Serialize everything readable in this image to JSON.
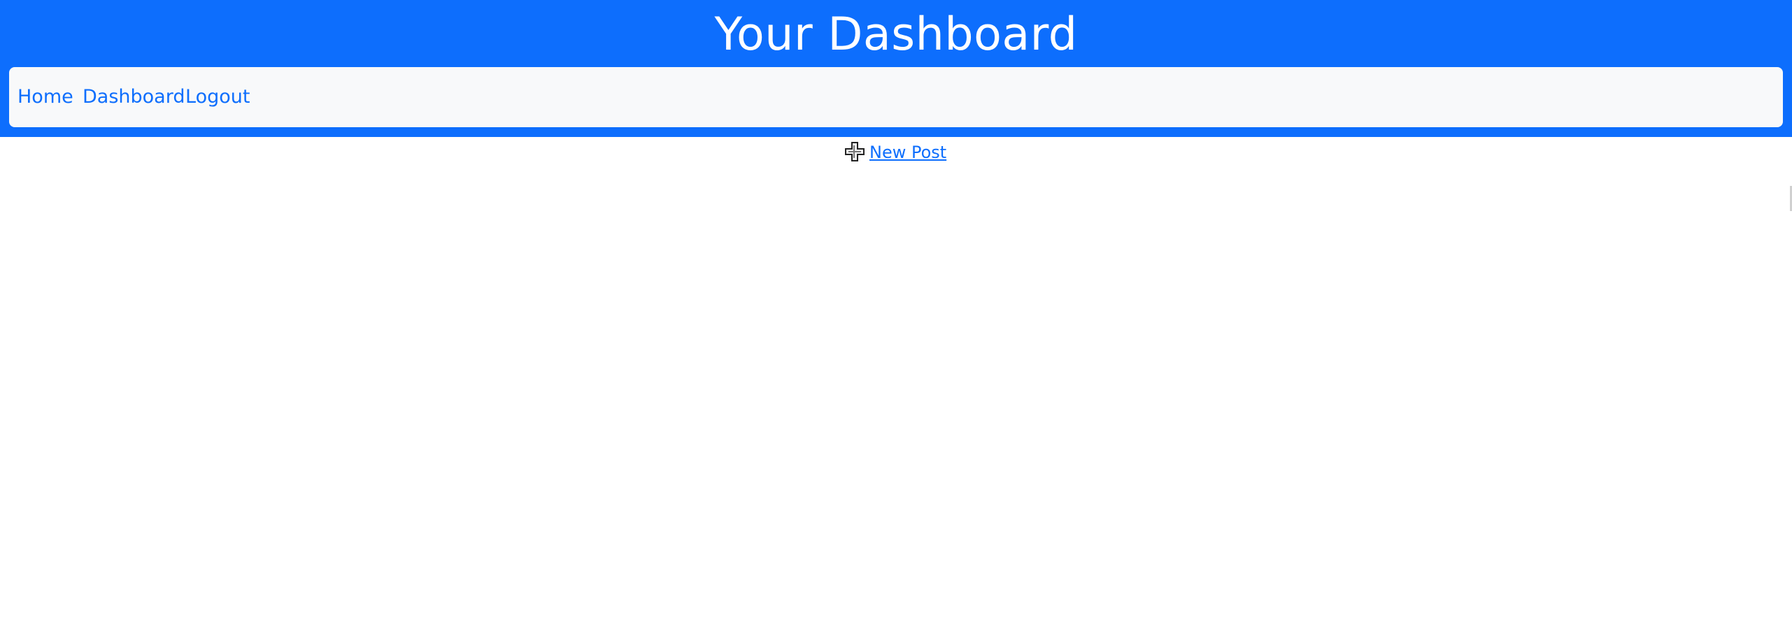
{
  "header": {
    "title": "Your Dashboard",
    "background_color": "#0d6efd"
  },
  "nav": {
    "items": [
      {
        "label": "Home"
      },
      {
        "label": "Dashboard"
      },
      {
        "label": "Logout"
      }
    ],
    "background_color": "#f8f9fa",
    "link_color": "#0d6efd"
  },
  "main": {
    "new_post": {
      "label": "New Post",
      "icon": "plus-icon"
    }
  }
}
